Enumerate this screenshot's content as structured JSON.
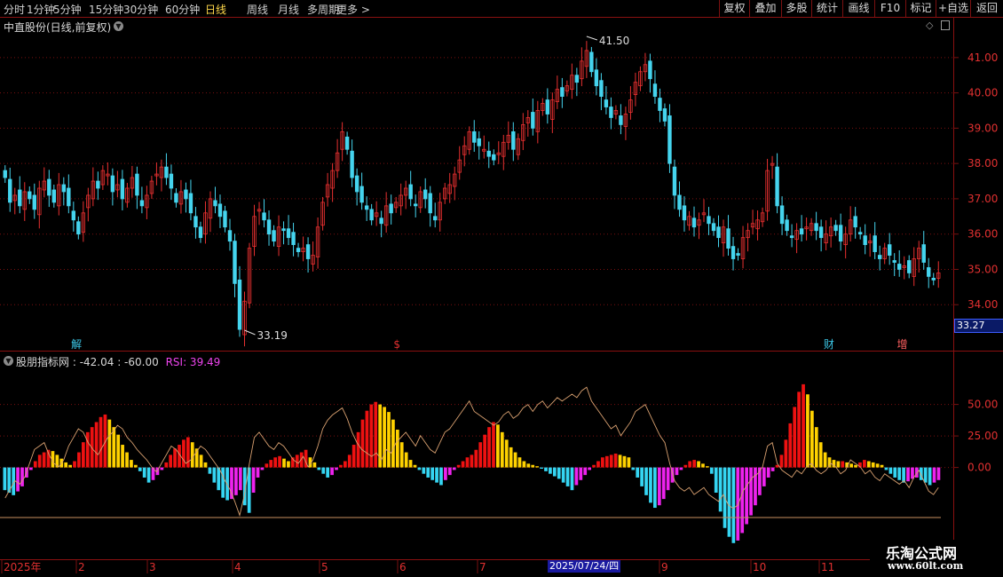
{
  "toolbar": {
    "periods": [
      "分时",
      "1分钟",
      "5分钟",
      "15分钟",
      "30分钟",
      "60分钟",
      "日线",
      "周线",
      "月线",
      "多周期",
      "更多 >"
    ],
    "active_period": "日线",
    "actions": [
      "复权",
      "叠加",
      "多股",
      "统计",
      "画线",
      "F10",
      "标记",
      "+自选",
      "返回"
    ]
  },
  "main_chart": {
    "title": "中直股份(日线,前复权)",
    "y_ticks": [
      "41.00",
      "40.00",
      "39.00",
      "38.00",
      "37.00",
      "36.00",
      "35.00",
      "34.00"
    ],
    "high_label": "41.50",
    "low_label": "33.19",
    "current_price": "33.27",
    "event_markers": [
      {
        "text": "解",
        "color": "#3cc8e8",
        "index": 14
      },
      {
        "text": "$",
        "color": "#e03030",
        "index": 80
      },
      {
        "text": "财",
        "color": "#3cc8e8",
        "index": 168
      },
      {
        "text": "增",
        "color": "#ff6060",
        "index": 183
      }
    ]
  },
  "indicator": {
    "name": "股朋指标网",
    "values_text": ": -42.04 : -60.00",
    "rsi_label": "RSI: 39.49",
    "y_ticks": [
      "50.00",
      "25.00",
      "0.00"
    ]
  },
  "time_axis": {
    "labels": [
      "2025年",
      "2",
      "3",
      "4",
      "5",
      "6",
      "7",
      "9",
      "10",
      "11"
    ],
    "cursor_label": "2025/07/24/四"
  },
  "watermark": {
    "line1": "乐淘公式网",
    "line2": "www.60lt.com"
  },
  "colors": {
    "up": "#e83030",
    "down": "#45d4ee",
    "hist_red": "#ee1111",
    "hist_yellow": "#ffd200",
    "hist_cyan": "#35d5f2",
    "hist_magenta": "#ee22ee",
    "rsi_line": "#d8a070",
    "grid": "#7a1010"
  },
  "chart_data": [
    {
      "type": "candlestick",
      "title": "中直股份(日线,前复权)",
      "ylim": [
        33.0,
        41.7
      ],
      "close": [
        37.6,
        36.9,
        37.1,
        36.8,
        37.2,
        37.0,
        36.7,
        37.3,
        37.5,
        37.1,
        36.9,
        37.4,
        37.2,
        36.8,
        36.4,
        36.0,
        36.6,
        37.1,
        37.5,
        37.3,
        37.8,
        37.7,
        37.2,
        37.4,
        37.0,
        37.3,
        37.6,
        37.1,
        36.8,
        37.1,
        37.5,
        37.7,
        37.9,
        37.6,
        37.3,
        36.9,
        37.2,
        37.0,
        36.6,
        36.2,
        35.9,
        36.6,
        37.0,
        36.8,
        36.5,
        36.2,
        35.8,
        34.6,
        33.3,
        34.1,
        35.6,
        36.5,
        36.7,
        36.4,
        36.0,
        35.8,
        36.2,
        36.1,
        35.9,
        35.7,
        35.5,
        35.6,
        35.3,
        35.4,
        36.2,
        36.9,
        37.4,
        37.8,
        38.3,
        38.9,
        38.4,
        37.6,
        37.2,
        36.9,
        36.7,
        36.4,
        36.6,
        36.3,
        36.8,
        36.6,
        36.9,
        37.1,
        37.3,
        37.0,
        36.8,
        37.2,
        37.0,
        36.6,
        36.4,
        36.9,
        37.3,
        37.4,
        37.7,
        38.1,
        38.5,
        38.9,
        38.6,
        38.5,
        38.4,
        38.2,
        38.1,
        38.3,
        38.6,
        38.8,
        38.4,
        38.7,
        39.1,
        39.3,
        39.0,
        39.5,
        39.7,
        39.4,
        39.8,
        40.1,
        39.9,
        40.2,
        40.5,
        40.3,
        40.9,
        41.2,
        40.6,
        40.2,
        39.9,
        39.6,
        39.3,
        39.5,
        39.1,
        39.4,
        39.8,
        40.3,
        40.6,
        40.8,
        40.4,
        39.9,
        39.5,
        39.2,
        38.0,
        37.1,
        36.7,
        36.4,
        36.5,
        36.2,
        36.4,
        36.6,
        36.3,
        36.1,
        35.9,
        36.2,
        35.6,
        35.3,
        35.4,
        35.9,
        36.1,
        36.3,
        36.4,
        36.6,
        37.8,
        38.0,
        36.8,
        36.3,
        36.1,
        35.9,
        36.1,
        36.0,
        36.2,
        36.3,
        36.1,
        35.9,
        36.0,
        36.2,
        36.1,
        35.8,
        36.0,
        36.4,
        36.2,
        36.0,
        35.7,
        35.8,
        35.5,
        35.3,
        35.6,
        35.4,
        35.2,
        35.0,
        35.1,
        34.9,
        35.3,
        35.6,
        35.2,
        34.8,
        34.7,
        34.9
      ]
    },
    {
      "type": "bar",
      "title": "股朋指标网",
      "ylim": [
        -70,
        80
      ],
      "hist": [
        -18,
        -20,
        -22,
        -19,
        -15,
        -8,
        -2,
        5,
        10,
        12,
        14,
        13,
        10,
        7,
        4,
        2,
        5,
        12,
        20,
        28,
        32,
        36,
        40,
        42,
        38,
        32,
        26,
        18,
        12,
        6,
        2,
        -3,
        -8,
        -12,
        -10,
        -6,
        -2,
        4,
        10,
        15,
        18,
        22,
        24,
        20,
        15,
        10,
        4,
        -5,
        -12,
        -18,
        -24,
        -26,
        -25,
        -22,
        -18,
        -30,
        -36,
        -20,
        -8,
        -2,
        3,
        6,
        8,
        9,
        7,
        5,
        8,
        10,
        12,
        14,
        8,
        4,
        -2,
        -5,
        -8,
        -6,
        -2,
        2,
        5,
        10,
        18,
        28,
        38,
        45,
        50,
        52,
        50,
        48,
        44,
        38,
        30,
        20,
        12,
        6,
        2,
        -2,
        -5,
        -8,
        -10,
        -12,
        -14,
        -10,
        -6,
        -2,
        2,
        5,
        8,
        10,
        14,
        20,
        26,
        32,
        36,
        34,
        28,
        22,
        16,
        12,
        8,
        5,
        3,
        2,
        1,
        -1,
        -3,
        -5,
        -7,
        -9,
        -12,
        -15,
        -18,
        -14,
        -10,
        -6,
        -2,
        2,
        5,
        8,
        9,
        10,
        11,
        10,
        9,
        8,
        -2,
        -8,
        -15,
        -22,
        -28,
        -32,
        -30,
        -25,
        -18,
        -12,
        -6,
        -2,
        2,
        5,
        6,
        5,
        3,
        1,
        -5,
        -20,
        -35,
        -48,
        -55,
        -60,
        -58,
        -52,
        -45,
        -38,
        -30,
        -22,
        -15,
        -8,
        -3,
        2,
        10,
        22,
        35,
        48,
        60,
        66,
        58,
        45,
        32,
        20,
        12,
        8,
        6,
        5,
        5,
        4,
        3,
        2,
        4,
        6,
        5,
        4,
        3,
        2,
        -2,
        -5,
        -8,
        -10,
        -12,
        -11,
        -9,
        -8,
        -10,
        -12,
        -14,
        -12,
        -10
      ],
      "rsi": [
        20,
        25,
        30,
        28,
        32,
        40,
        48,
        50,
        52,
        45,
        40,
        38,
        42,
        50,
        55,
        60,
        58,
        52,
        48,
        45,
        50,
        55,
        58,
        62,
        60,
        55,
        52,
        48,
        45,
        42,
        38,
        35,
        40,
        45,
        50,
        48,
        44,
        40,
        42,
        46,
        50,
        48,
        44,
        40,
        36,
        30,
        25,
        18,
        10,
        22,
        40,
        55,
        58,
        54,
        50,
        48,
        52,
        50,
        46,
        42,
        40,
        44,
        38,
        42,
        50,
        60,
        65,
        68,
        70,
        72,
        66,
        58,
        52,
        48,
        46,
        44,
        46,
        42,
        48,
        46,
        52,
        55,
        58,
        54,
        50,
        56,
        52,
        48,
        46,
        52,
        58,
        60,
        64,
        68,
        72,
        76,
        70,
        68,
        66,
        64,
        62,
        64,
        68,
        70,
        66,
        68,
        72,
        74,
        70,
        74,
        76,
        72,
        75,
        78,
        76,
        78,
        80,
        78,
        82,
        84,
        76,
        72,
        68,
        64,
        60,
        62,
        56,
        60,
        64,
        70,
        72,
        74,
        68,
        62,
        56,
        52,
        40,
        30,
        26,
        24,
        26,
        22,
        24,
        26,
        22,
        20,
        18,
        22,
        16,
        14,
        16,
        24,
        28,
        32,
        34,
        38,
        50,
        52,
        40,
        36,
        34,
        32,
        36,
        34,
        38,
        40,
        36,
        34,
        36,
        40,
        38,
        34,
        36,
        42,
        40,
        38,
        34,
        36,
        32,
        30,
        34,
        32,
        30,
        28,
        30,
        26,
        32,
        36,
        30,
        24,
        22,
        26
      ]
    }
  ]
}
